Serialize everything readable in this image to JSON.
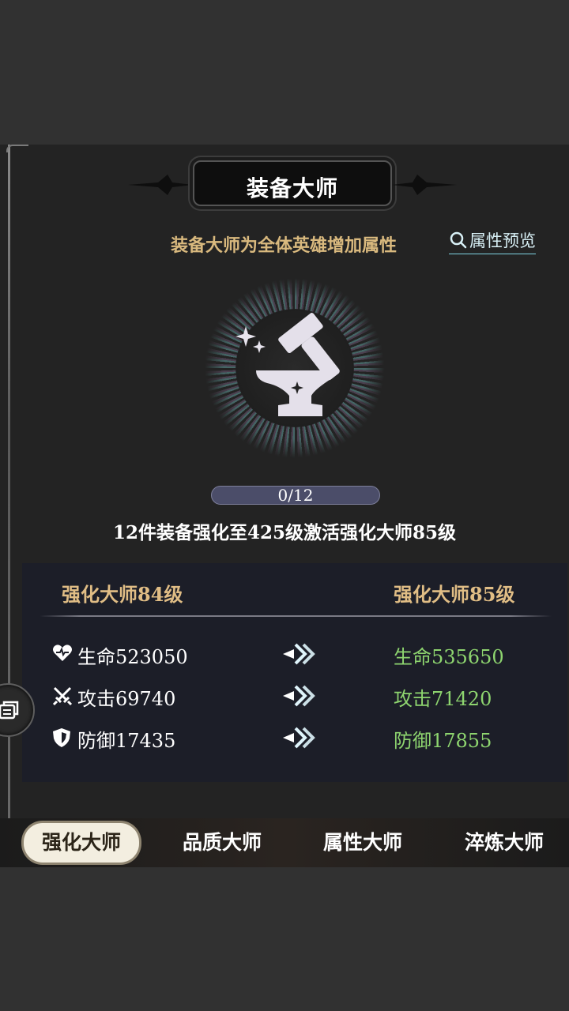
{
  "header": {
    "title": "装备大师"
  },
  "subtitle": "装备大师为全体英雄增加属性",
  "preview_link": {
    "label": "属性预览",
    "icon": "search-icon"
  },
  "emblem": {
    "icon": "anvil-hammer-icon"
  },
  "progress": {
    "text": "0/12",
    "current": 0,
    "total": 12
  },
  "requirement_text": "12件装备强化至425级激活强化大师85级",
  "compare": {
    "current_level": "强化大师84级",
    "next_level": "强化大师85级",
    "rows": [
      {
        "icon": "heart-icon",
        "current": "生命523050",
        "next": "生命535650"
      },
      {
        "icon": "crossed-swords-icon",
        "current": "攻击69740",
        "next": "攻击71420"
      },
      {
        "icon": "shield-icon",
        "current": "防御17435",
        "next": "防御17855"
      }
    ]
  },
  "colors": {
    "next_value": "#8ed56f",
    "level_label": "#e0bd85",
    "subtitle": "#d9b97e"
  },
  "tabs": [
    {
      "label": "强化大师",
      "active": true
    },
    {
      "label": "品质大师",
      "active": false
    },
    {
      "label": "属性大师",
      "active": false
    },
    {
      "label": "淬炼大师",
      "active": false
    }
  ]
}
